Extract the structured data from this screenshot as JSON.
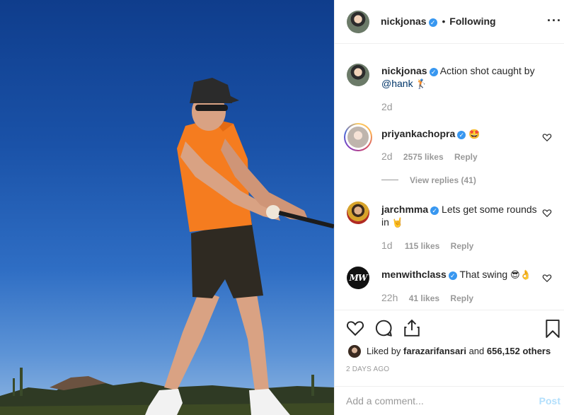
{
  "post": {
    "author": "nickjonas",
    "separator": "•",
    "follow_status": "Following",
    "more_icon": "more-horizontal-icon"
  },
  "caption": {
    "username": "nickjonas",
    "text": "Action shot caught by",
    "mention": "@hank",
    "emoji": "🏌",
    "time": "2d"
  },
  "comments": [
    {
      "username": "priyankachopra",
      "text": "",
      "emoji": "🤩",
      "time": "2d",
      "likes": "2575 likes",
      "reply": "Reply",
      "view_replies": "View replies (41)"
    },
    {
      "username": "jarchmma",
      "text": "Lets get some rounds in",
      "emoji": "🤘",
      "time": "1d",
      "likes": "115 likes",
      "reply": "Reply"
    },
    {
      "username": "menwithclass",
      "text": "That swing",
      "emoji": "😎👌",
      "time": "22h",
      "likes": "41 likes",
      "reply": "Reply",
      "avatar_text": "MW"
    }
  ],
  "liked_by": {
    "prefix": "Liked by",
    "user": "farazarifansari",
    "and": "and",
    "others": "656,152 others"
  },
  "date": "2 DAYS AGO",
  "comment_input": {
    "placeholder": "Add a comment...",
    "post_label": "Post"
  },
  "colors": {
    "verified": "#3897f0",
    "link": "#003569",
    "shirt": "#f57c1f",
    "sky": "#1a52a8"
  }
}
